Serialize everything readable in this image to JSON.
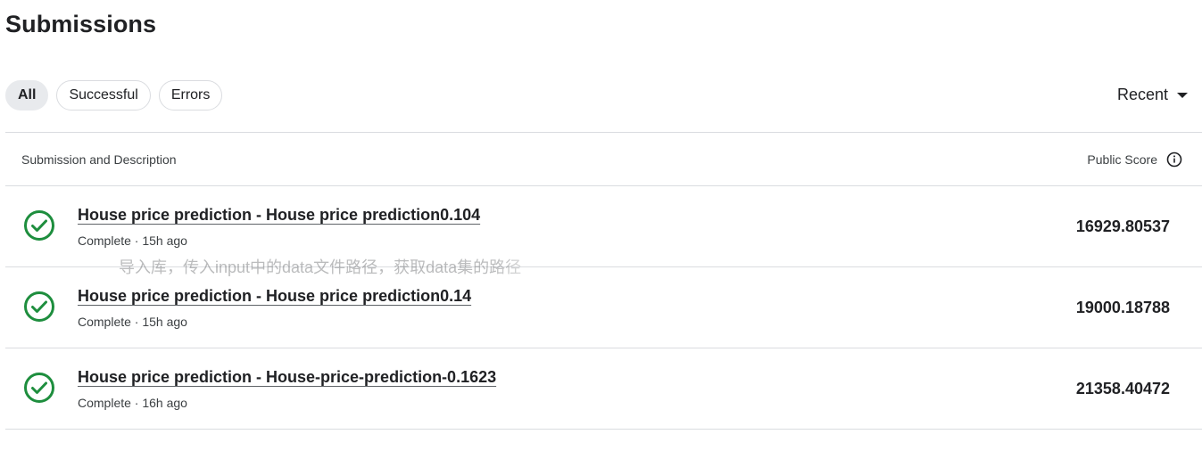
{
  "page": {
    "title": "Submissions"
  },
  "filters": [
    {
      "label": "All",
      "active": true
    },
    {
      "label": "Successful",
      "active": false
    },
    {
      "label": "Errors",
      "active": false
    }
  ],
  "sort": {
    "label": "Recent",
    "icon": "caret-down-icon"
  },
  "table": {
    "headers": {
      "left": "Submission and Description",
      "right": "Public Score",
      "right_icon": "info-icon"
    },
    "rows": [
      {
        "status_icon": "check-circle-icon",
        "title": "House price prediction - House price prediction0.104",
        "meta": "Complete · 15h ago",
        "score": "16929.80537"
      },
      {
        "status_icon": "check-circle-icon",
        "title": "House price prediction - House price prediction0.14",
        "meta": "Complete · 15h ago",
        "score": "19000.18788"
      },
      {
        "status_icon": "check-circle-icon",
        "title": "House price prediction - House-price-prediction-0.1623",
        "meta": "Complete · 16h ago",
        "score": "21358.40472"
      }
    ]
  },
  "tooltip": {
    "text": "导入库，传入input中的data文件路径，获取data集的路径"
  },
  "colors": {
    "success": "#1e8e3e",
    "divider": "#dadce0",
    "chip_active_bg": "#e8eaed",
    "text_primary": "#202124"
  }
}
